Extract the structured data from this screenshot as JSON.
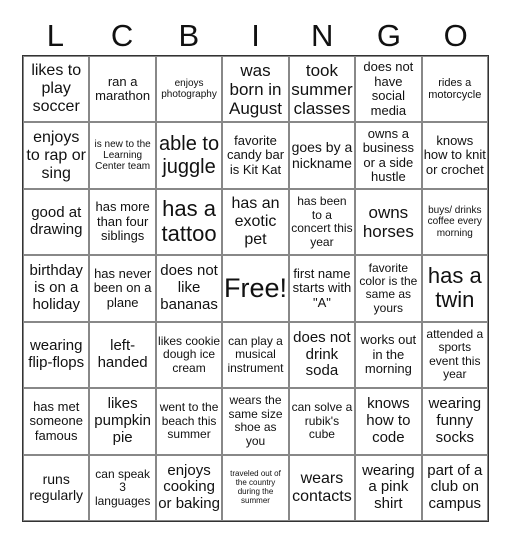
{
  "header": [
    "L",
    "C",
    "B",
    "I",
    "N",
    "G",
    "O"
  ],
  "cells": [
    [
      "likes to play soccer",
      "ran a marathon",
      "enjoys photography",
      "was born in August",
      "took summer classes",
      "does not have social media",
      "rides a motorcycle"
    ],
    [
      "enjoys to rap or sing",
      "is new to the Learning Center team",
      "able to juggle",
      "favorite candy bar is Kit Kat",
      "goes by a nickname",
      "owns a business or a side hustle",
      "knows how to knit or crochet"
    ],
    [
      "good at drawing",
      "has more than four siblings",
      "has a tattoo",
      "has an exotic pet",
      "has been to a concert this year",
      "owns horses",
      "buys/ drinks coffee every morning"
    ],
    [
      "birthday is on a holiday",
      "has never been on a plane",
      "does not like bananas",
      "Free!",
      "first name starts with \"A\"",
      "favorite color is the same as yours",
      "has a twin"
    ],
    [
      "wearing flip-flops",
      "left-handed",
      "likes cookie dough ice cream",
      "can play a musical instrument",
      "does not drink soda",
      "works out in the morning",
      "attended a sports event this year"
    ],
    [
      "has met someone famous",
      "likes pumpkin pie",
      "went to the beach this summer",
      "wears the same size shoe as you",
      "can solve a rubik's cube",
      "knows how to code",
      "wearing funny socks"
    ],
    [
      "runs regularly",
      "can speak 3 languages",
      "enjoys cooking or baking",
      "traveled out of the country during the summer",
      "wears contacts",
      "wearing a pink shirt",
      "part of a club on campus"
    ]
  ]
}
